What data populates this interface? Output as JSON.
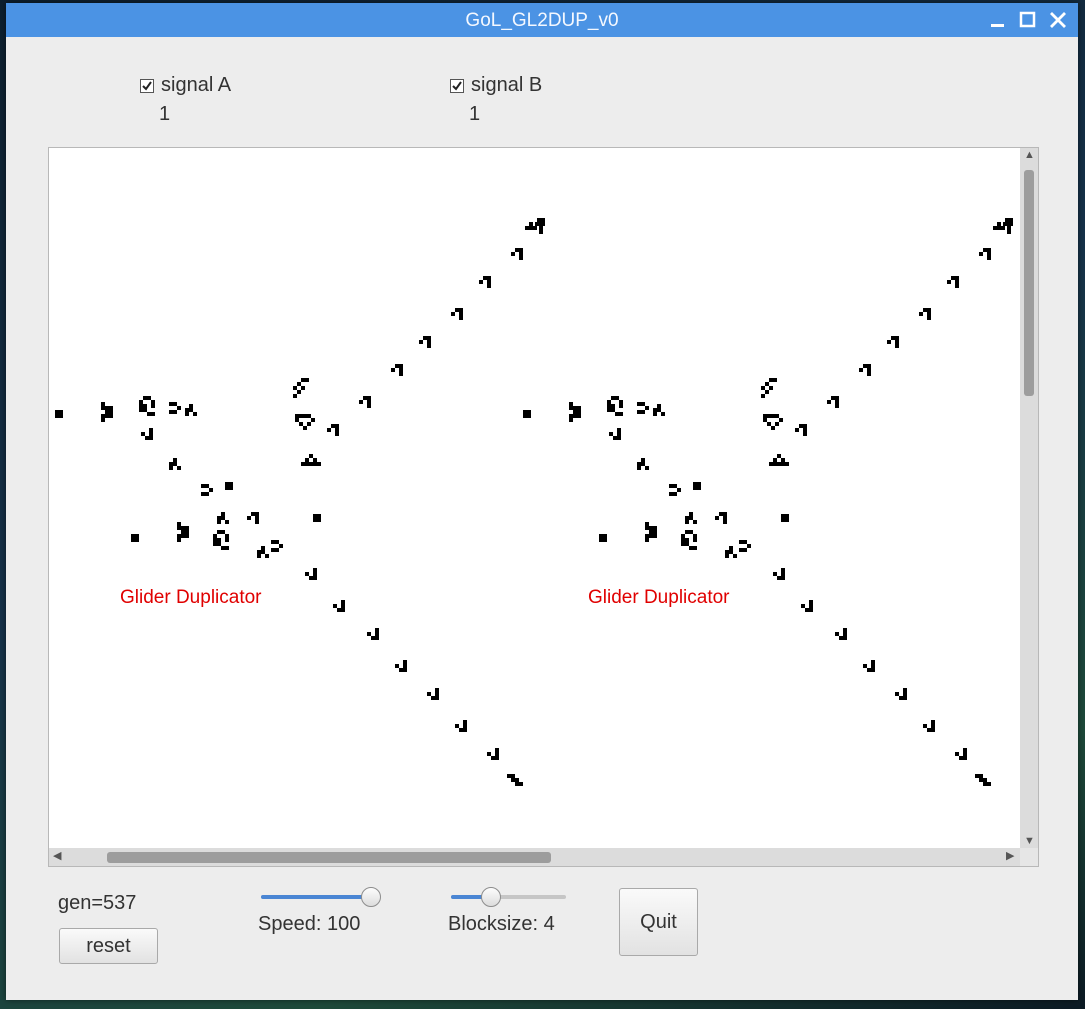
{
  "window": {
    "title": "GoL_GL2DUP_v0"
  },
  "signals": [
    {
      "label": "signal A",
      "checked": true,
      "value": "1"
    },
    {
      "label": "signal B",
      "checked": true,
      "value": "1"
    }
  ],
  "canvas": {
    "annotations": [
      "Glider Duplicator",
      "Glider Duplicator"
    ],
    "annotation_color": "#e00000"
  },
  "controls": {
    "gen_label": "gen=537",
    "reset_label": "reset",
    "speed_label": "Speed: 100",
    "speed_level": 1.0,
    "blocksize_label": "Blocksize: 4",
    "blocksize_level": 0.3,
    "quit_label": "Quit"
  },
  "colors": {
    "titlebar": "#4b93e4",
    "accent": "#4a86d4"
  },
  "icons": [
    "minimize-icon",
    "maximize-icon",
    "close-icon",
    "checkbox-checked-icon",
    "scroll-arrow-icon"
  ]
}
